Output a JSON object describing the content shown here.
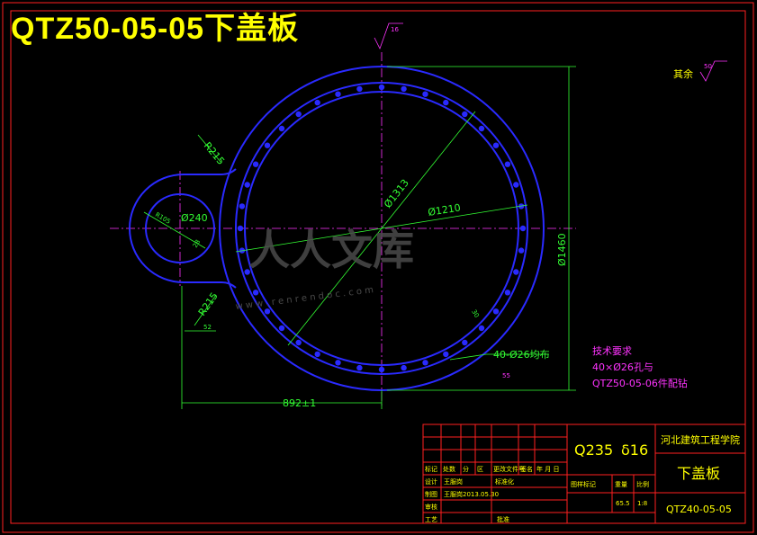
{
  "title": "QTZ50-05-05下盖板",
  "surface_finish_top": "16",
  "other_finish": {
    "label": "其余",
    "value": "50"
  },
  "dims": {
    "r215_top": "R215",
    "r215_bottom": "R215",
    "r105": "R105",
    "d240": "Ø240",
    "angle": "28",
    "d1313": "Ø1313",
    "d1210": "Ø1210",
    "d1460": "Ø1460",
    "d52": "52",
    "len892": "892±1",
    "holes": "40-Ø26均布",
    "hole_ang": "30",
    "hole_small": "55"
  },
  "tech_req": {
    "title": "技术要求",
    "line1": "40×Ø26孔与",
    "line2": "QTZ50-05-06件配钻"
  },
  "watermark": {
    "text": "人人文库",
    "url": "w w w . r e n r e n d o c . c o m"
  },
  "title_block": {
    "material": "Q235",
    "thickness": "δ16",
    "school": "河北建筑工程学院",
    "part_name": "下盖板",
    "part_code": "QTZ40-05-05",
    "row_labels": [
      "标记",
      "处数",
      "分",
      "区",
      "更改文件号",
      "签名",
      "年 月 日"
    ],
    "design": "设计",
    "designer": "王服岗",
    "standard": "标准化",
    "draw": "制图",
    "drafter": "王服岗",
    "draw_date": "2013.05.30",
    "review": "审核",
    "process": "工艺",
    "approve": "批准",
    "stage": "图样标记",
    "weight": "重量",
    "scale": "比例",
    "weight_val": "65.5",
    "scale_val": "1:8"
  }
}
